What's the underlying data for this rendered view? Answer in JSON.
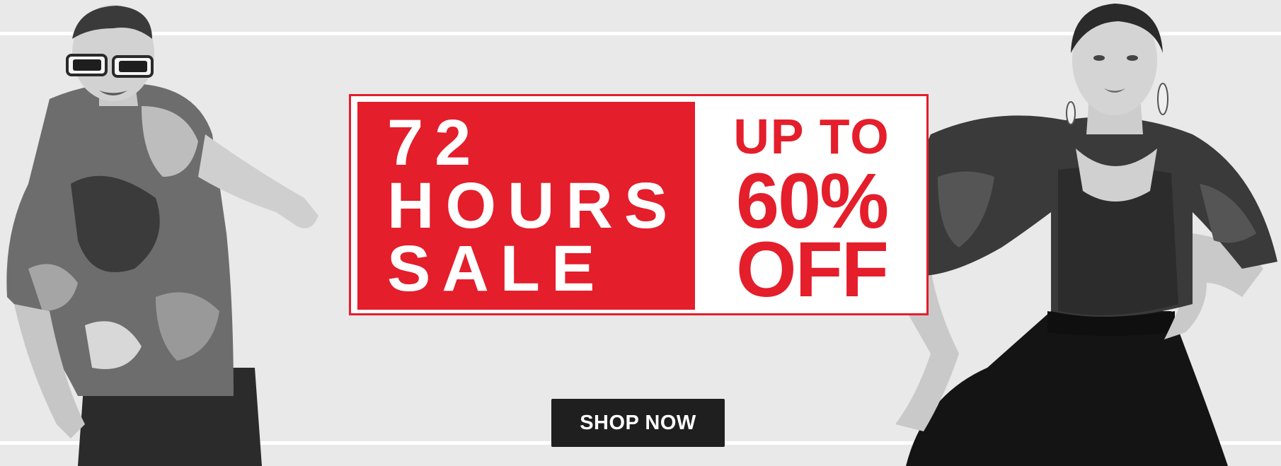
{
  "banner": {
    "background_color": "#e9e9e9",
    "accent_color": "#e41e2b",
    "sale_lines": [
      "72",
      "HOURS",
      "SALE"
    ],
    "offer_lines": [
      "UP TO",
      "60%",
      "OFF"
    ],
    "cta_label": "SHOP NOW",
    "cta_color": "#1f1f1f",
    "models": [
      "male-model-image",
      "female-model-image"
    ]
  }
}
